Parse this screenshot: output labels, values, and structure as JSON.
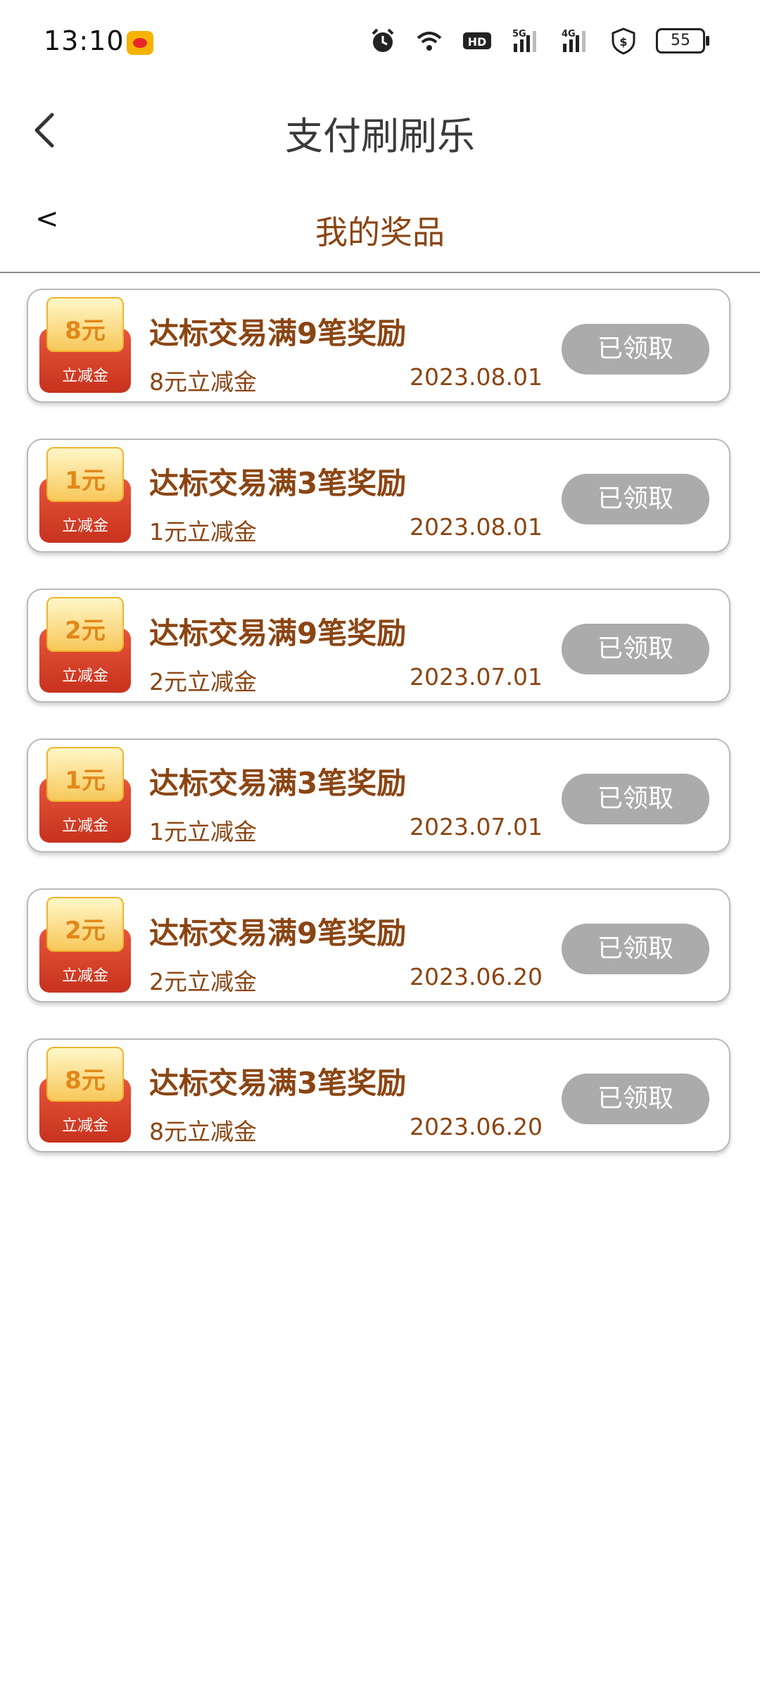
{
  "status_bar": {
    "time": "13:10",
    "battery": "55",
    "icons": [
      "weibo-icon",
      "alarm-icon",
      "wifi-icon",
      "hd-icon",
      "signal-5g-icon",
      "signal-4g-icon",
      "shield-dollar-icon",
      "battery-icon"
    ]
  },
  "header": {
    "title": "支付刷刷乐"
  },
  "subheader": {
    "back": "<",
    "title": "我的奖品"
  },
  "prizes": [
    {
      "amount": "8元",
      "label": "立减金",
      "title": "达标交易满9笔奖励",
      "subtitle": "8元立减金",
      "date": "2023.08.01",
      "button": "已领取"
    },
    {
      "amount": "1元",
      "label": "立减金",
      "title": "达标交易满3笔奖励",
      "subtitle": "1元立减金",
      "date": "2023.08.01",
      "button": "已领取"
    },
    {
      "amount": "2元",
      "label": "立减金",
      "title": "达标交易满9笔奖励",
      "subtitle": "2元立减金",
      "date": "2023.07.01",
      "button": "已领取"
    },
    {
      "amount": "1元",
      "label": "立减金",
      "title": "达标交易满3笔奖励",
      "subtitle": "1元立减金",
      "date": "2023.07.01",
      "button": "已领取"
    },
    {
      "amount": "2元",
      "label": "立减金",
      "title": "达标交易满9笔奖励",
      "subtitle": "2元立减金",
      "date": "2023.06.20",
      "button": "已领取"
    },
    {
      "amount": "8元",
      "label": "立减金",
      "title": "达标交易满3笔奖励",
      "subtitle": "8元立减金",
      "date": "2023.06.20",
      "button": "已领取"
    }
  ],
  "colors": {
    "accent_text": "#8b4513",
    "button_disabled": "#ababab",
    "voucher_red": "#d63c24",
    "voucher_gold": "#f7c85a"
  }
}
